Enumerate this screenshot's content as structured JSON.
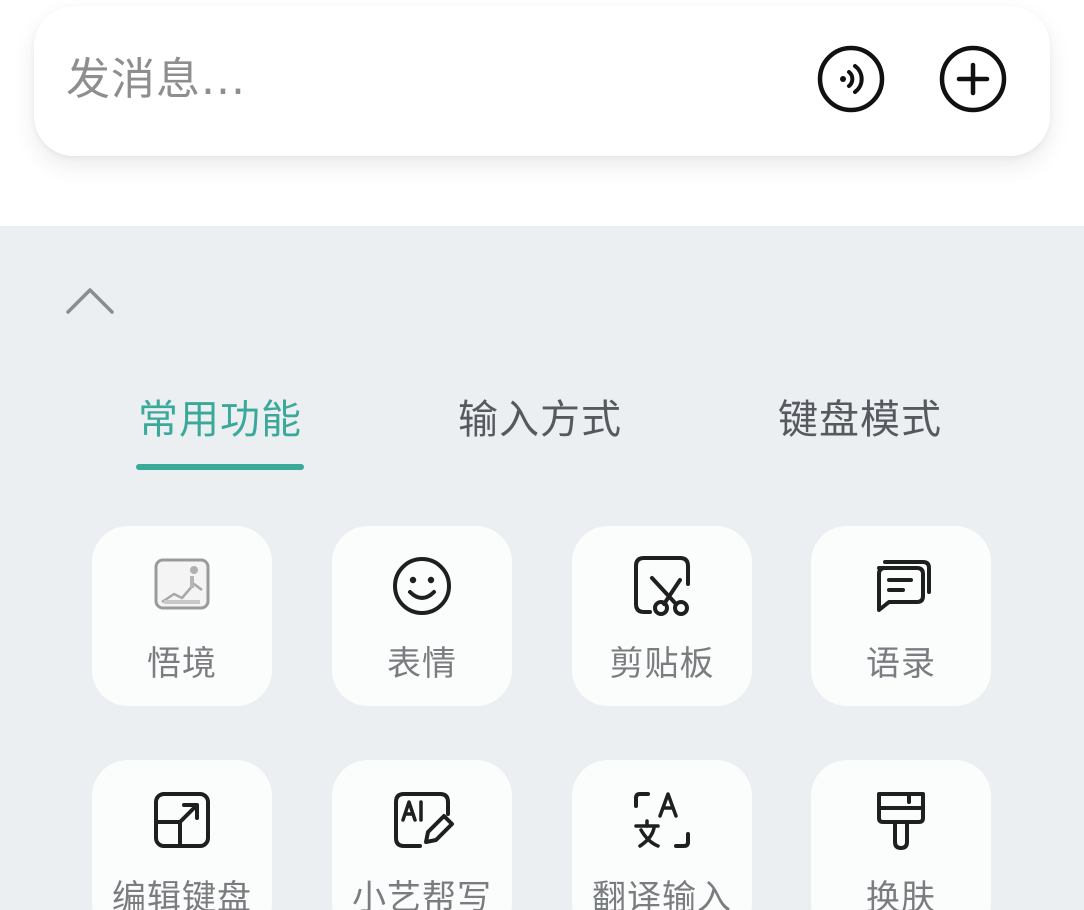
{
  "message_bar": {
    "placeholder": "发消息..."
  },
  "icons": {
    "voice": "voice-icon",
    "plus": "plus-circle-icon",
    "collapse": "chevron-up-icon"
  },
  "tabs": [
    {
      "label": "常用功能",
      "active": true
    },
    {
      "label": "输入方式",
      "active": false
    },
    {
      "label": "键盘模式",
      "active": false
    }
  ],
  "tiles": [
    {
      "label": "悟境",
      "icon": "image-gallery-icon"
    },
    {
      "label": "表情",
      "icon": "smiley-face-icon"
    },
    {
      "label": "剪贴板",
      "icon": "clipboard-scissors-icon"
    },
    {
      "label": "语录",
      "icon": "chat-bubbles-icon"
    },
    {
      "label": "编辑键盘",
      "icon": "edit-keyboard-icon"
    },
    {
      "label": "小艺帮写",
      "icon": "ai-write-icon"
    },
    {
      "label": "翻译输入",
      "icon": "translate-icon"
    },
    {
      "label": "换肤",
      "icon": "paint-brush-icon"
    }
  ],
  "colors": {
    "accent": "#3aa99a",
    "panel_bg": "#eceff2",
    "tile_bg": "#fbfcfc",
    "icon_stroke": "#1f1f1f"
  }
}
